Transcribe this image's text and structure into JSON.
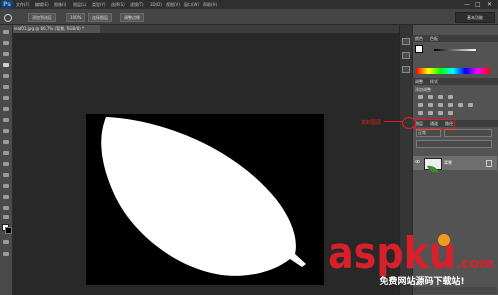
{
  "app": {
    "logo": "Ps"
  },
  "menu": [
    "文件(F)",
    "编辑(E)",
    "图像(I)",
    "图层(L)",
    "类型(Y)",
    "选择(S)",
    "滤镜(T)",
    "3D(D)",
    "视图(V)",
    "窗口(W)",
    "帮助(H)"
  ],
  "window_controls": {
    "minimize": "—",
    "maximize": "□",
    "close": "✕"
  },
  "options_bar": {
    "mode": "添加到选区",
    "feather": "100%",
    "btn_sample": "连接图层",
    "btn_refine": "调整边缘",
    "workspace": "基本功能"
  },
  "document_tab": {
    "title": "leaf01.jpg @ 66.7% (背景, RGB/8) *"
  },
  "panels": {
    "color_tabs": [
      "颜色",
      "色板"
    ],
    "adjust_tabs": [
      "调整",
      "样式"
    ],
    "adjust_title": "添加调整",
    "layer_tabs": [
      "图层",
      "通道",
      "路径"
    ],
    "blend_mode": "正常",
    "layers": [
      {
        "name": "背景",
        "visible": true,
        "locked": true
      }
    ]
  },
  "annotation": {
    "text": "复制图层",
    "color": "#e02020"
  },
  "watermark": {
    "brand": "aspku",
    "tld": ".com",
    "sub": "免费网站源码下载站!",
    "colors": {
      "letters": "#d8202a",
      "accent": "#f29c1f"
    }
  }
}
